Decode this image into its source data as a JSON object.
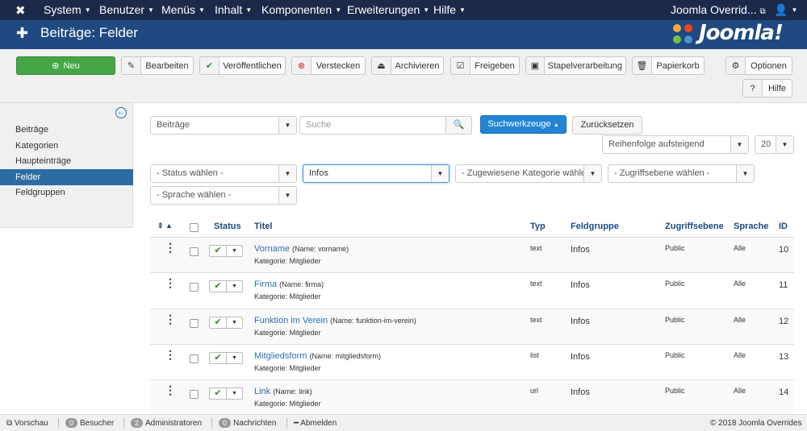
{
  "nav": {
    "items": [
      "System",
      "Benutzer",
      "Menüs",
      "Inhalt",
      "Komponenten",
      "Erweiterungen",
      "Hilfe"
    ],
    "site_link": "Joomla Overrid...",
    "user_icon": "user-icon"
  },
  "header": {
    "title": "Beiträge: Felder",
    "brand": "Joomla!"
  },
  "toolbar": {
    "new": "Neu",
    "edit": "Bearbeiten",
    "publish": "Veröffentlichen",
    "unpublish": "Verstecken",
    "archive": "Archivieren",
    "checkin": "Freigeben",
    "batch": "Stapelverarbeitung",
    "trash": "Papierkorb",
    "options": "Optionen",
    "help": "Hilfe"
  },
  "sidebar": {
    "items": [
      "Beiträge",
      "Kategorien",
      "Haupteinträge",
      "Felder",
      "Feldgruppen"
    ],
    "active": "Felder"
  },
  "filters": {
    "context": "Beiträge",
    "search_placeholder": "Suche",
    "search_tools": "Suchwerkzeuge",
    "reset": "Zurücksetzen",
    "ordering": "Reihenfolge aufsteigend",
    "limit": "20",
    "status": "- Status wählen -",
    "group": "Infos",
    "category": "- Zugewiesene Kategorie wähle",
    "access": "- Zugriffsebene wählen -",
    "language": "- Sprache wählen -"
  },
  "table": {
    "headers": {
      "status": "Status",
      "title": "Titel",
      "type": "Typ",
      "group": "Feldgruppe",
      "access": "Zugriffsebene",
      "language": "Sprache",
      "id": "ID"
    },
    "rows": [
      {
        "title": "Vorname",
        "name": "(Name: vorname)",
        "category": "Kategorie: Mitglieder",
        "type": "text",
        "group": "Infos",
        "access": "Public",
        "language": "Alle",
        "id": "10"
      },
      {
        "title": "Firma",
        "name": "(Name: firma)",
        "category": "Kategorie: Mitglieder",
        "type": "text",
        "group": "Infos",
        "access": "Public",
        "language": "Alle",
        "id": "11"
      },
      {
        "title": "Funktion im Verein",
        "name": "(Name: funktion-im-verein)",
        "category": "Kategorie: Mitglieder",
        "type": "text",
        "group": "Infos",
        "access": "Public",
        "language": "Alle",
        "id": "12"
      },
      {
        "title": "Mitgliedsform",
        "name": "(Name: mitgliedsform)",
        "category": "Kategorie: Mitglieder",
        "type": "list",
        "group": "Infos",
        "access": "Public",
        "language": "Alle",
        "id": "13"
      },
      {
        "title": "Link",
        "name": "(Name: link)",
        "category": "Kategorie: Mitglieder",
        "type": "url",
        "group": "Infos",
        "access": "Public",
        "language": "Alle",
        "id": "14"
      }
    ]
  },
  "footer": {
    "preview": "Vorschau",
    "visitors_count": "0",
    "visitors": "Besucher",
    "admins_count": "2",
    "admins": "Administratoren",
    "messages_count": "0",
    "messages": "Nachrichten",
    "logout": "Abmelden",
    "copyright": "© 2018 Joomla Overrides"
  }
}
